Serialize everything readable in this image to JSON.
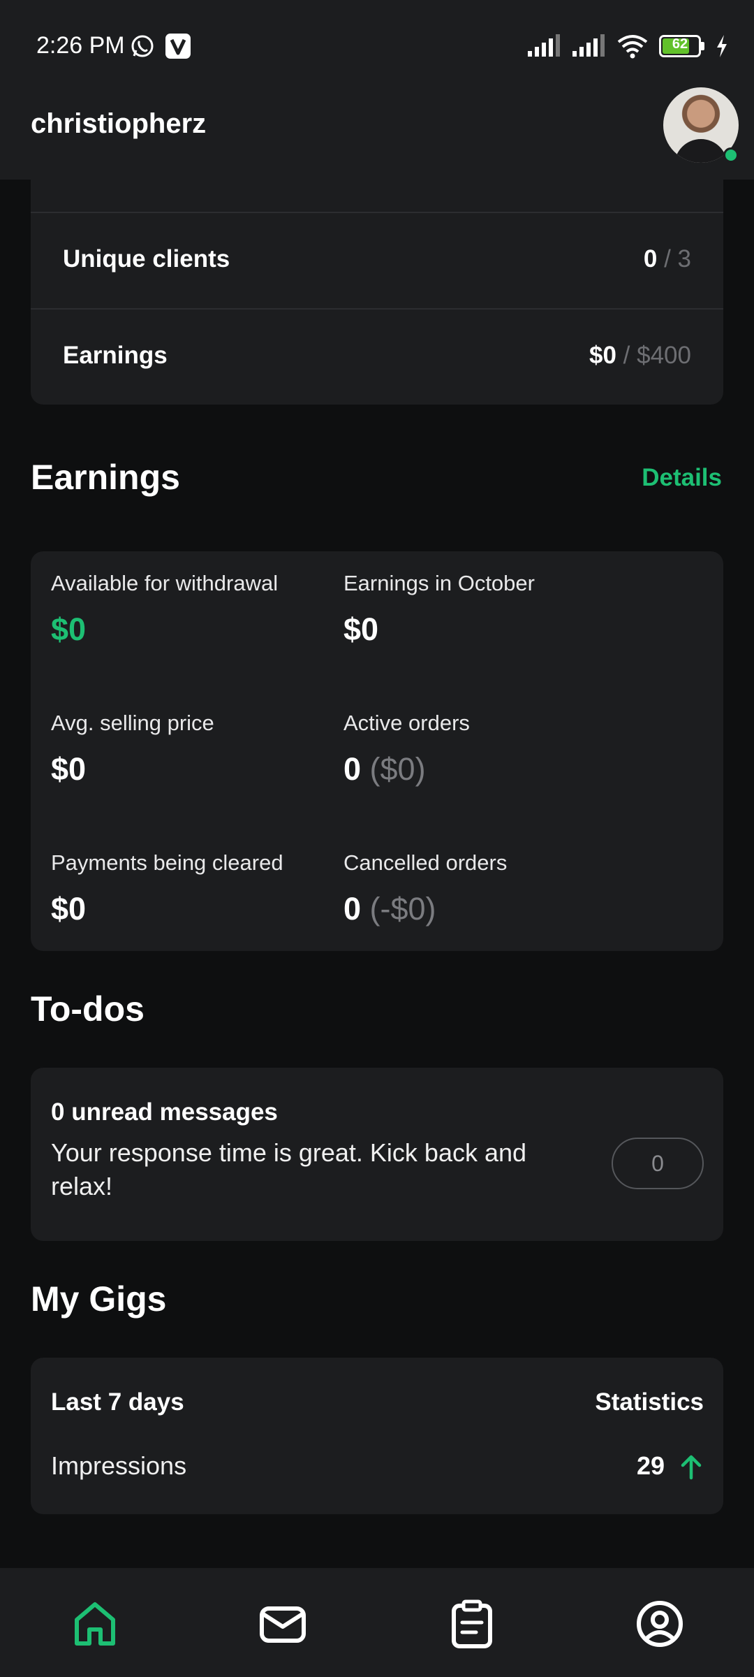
{
  "status_bar": {
    "time": "2:26 PM",
    "battery_level": "62",
    "icons": [
      "whatsapp-icon",
      "v-app-icon",
      "signal-icon",
      "signal-icon",
      "wifi-icon",
      "battery-icon",
      "charging-icon"
    ]
  },
  "header": {
    "username": "christiopherz",
    "avatar": "avatar",
    "online": true
  },
  "level_card": {
    "rows": [
      {
        "label": "Unique clients",
        "value": "0",
        "target": " / 3"
      },
      {
        "label": "Earnings",
        "value": "$0",
        "target": " / $400"
      }
    ]
  },
  "earnings": {
    "title": "Earnings",
    "details_label": "Details",
    "stats": [
      {
        "label": "Available for withdrawal",
        "value": "$0",
        "extra": ""
      },
      {
        "label": "Earnings in October",
        "value": "$0",
        "extra": ""
      },
      {
        "label": "Avg. selling price",
        "value": "$0",
        "extra": ""
      },
      {
        "label": "Active orders",
        "value": "0",
        "extra": " ($0)"
      },
      {
        "label": "Payments being cleared",
        "value": "$0",
        "extra": ""
      },
      {
        "label": "Cancelled orders",
        "value": "0",
        "extra": " (-$0)"
      }
    ]
  },
  "todos": {
    "title": "To-dos",
    "item_title": "0 unread messages",
    "item_text": "Your response time is great. Kick back and relax!",
    "count": "0"
  },
  "gigs": {
    "title": "My Gigs",
    "period": "Last 7 days",
    "statistics_label": "Statistics",
    "metric_label": "Impressions",
    "metric_value": "29",
    "trend": "up"
  },
  "bottom_nav": {
    "items": [
      "home-icon",
      "inbox-icon",
      "orders-icon",
      "profile-icon"
    ],
    "active": "home-icon"
  },
  "colors": {
    "accent": "#1dbf73",
    "background": "#0e0f10",
    "card": "#1c1d1f"
  }
}
